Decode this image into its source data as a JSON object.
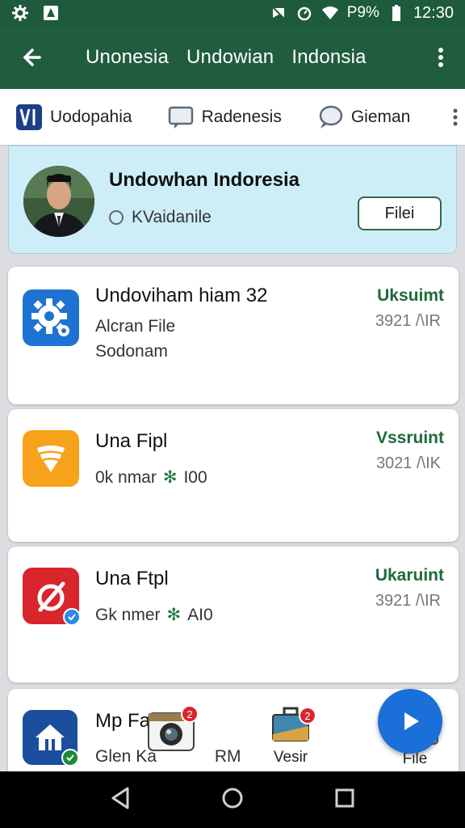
{
  "status_bar": {
    "time": "12:30",
    "battery": "P9%",
    "icons": [
      "gear-icon",
      "app-notification-icon",
      "mute-icon",
      "alarm-icon",
      "wifi-icon",
      "battery-icon"
    ]
  },
  "app_bar": {
    "titles": [
      "Unonesia",
      "Undowian",
      "Indonsia"
    ],
    "icons": [
      "back-arrow-icon",
      "more-vert-icon"
    ]
  },
  "tabs": [
    {
      "label": "Uodopahia",
      "icon": "vi-logo-icon"
    },
    {
      "label": "Radenesis",
      "icon": "chat-bubble-icon"
    },
    {
      "label": "Gieman",
      "icon": "speech-icon"
    }
  ],
  "profile": {
    "name": "Undowhan Indoresia",
    "status": "KVaidanile",
    "button": "Filei"
  },
  "items": [
    {
      "title": "Undoviham hiam 32",
      "line1": "Alcran File",
      "line2": "Sodonam",
      "status": "Uksuimt",
      "meta": "3921 /\\IR",
      "icon": "settings-gear-icon",
      "color": "#1e73d2"
    },
    {
      "title": "Una Fipl",
      "line1": "0k  nmar",
      "line1_b": "I00",
      "status": "Vssruint",
      "meta": "3021 /\\IK",
      "icon": "orange-fan-icon",
      "color": "#f7a21b"
    },
    {
      "title": "Una Ftpl",
      "line1": "Gk  nmer",
      "line1_b": "AI0",
      "status": "Ukaruint",
      "meta": "3921 /\\IR",
      "icon": "red-slash-icon",
      "color": "#d8262c"
    },
    {
      "title": "Mp Fa",
      "line1": "Glen Ka",
      "line1_b": "RM",
      "icon": "home-icon",
      "color": "#1b4f9e"
    }
  ],
  "bottom_tabs": [
    {
      "label": "",
      "icon": "camera-icon",
      "badge": "2"
    },
    {
      "label": "Vesir",
      "icon": "briefcase-icon",
      "badge": "2"
    },
    {
      "label": "File",
      "icon": "folder-icon"
    }
  ],
  "fab": {
    "icon": "play-icon"
  },
  "nav_bar": {
    "icons": [
      "back-triangle-icon",
      "home-circle-icon",
      "recents-square-icon"
    ]
  }
}
